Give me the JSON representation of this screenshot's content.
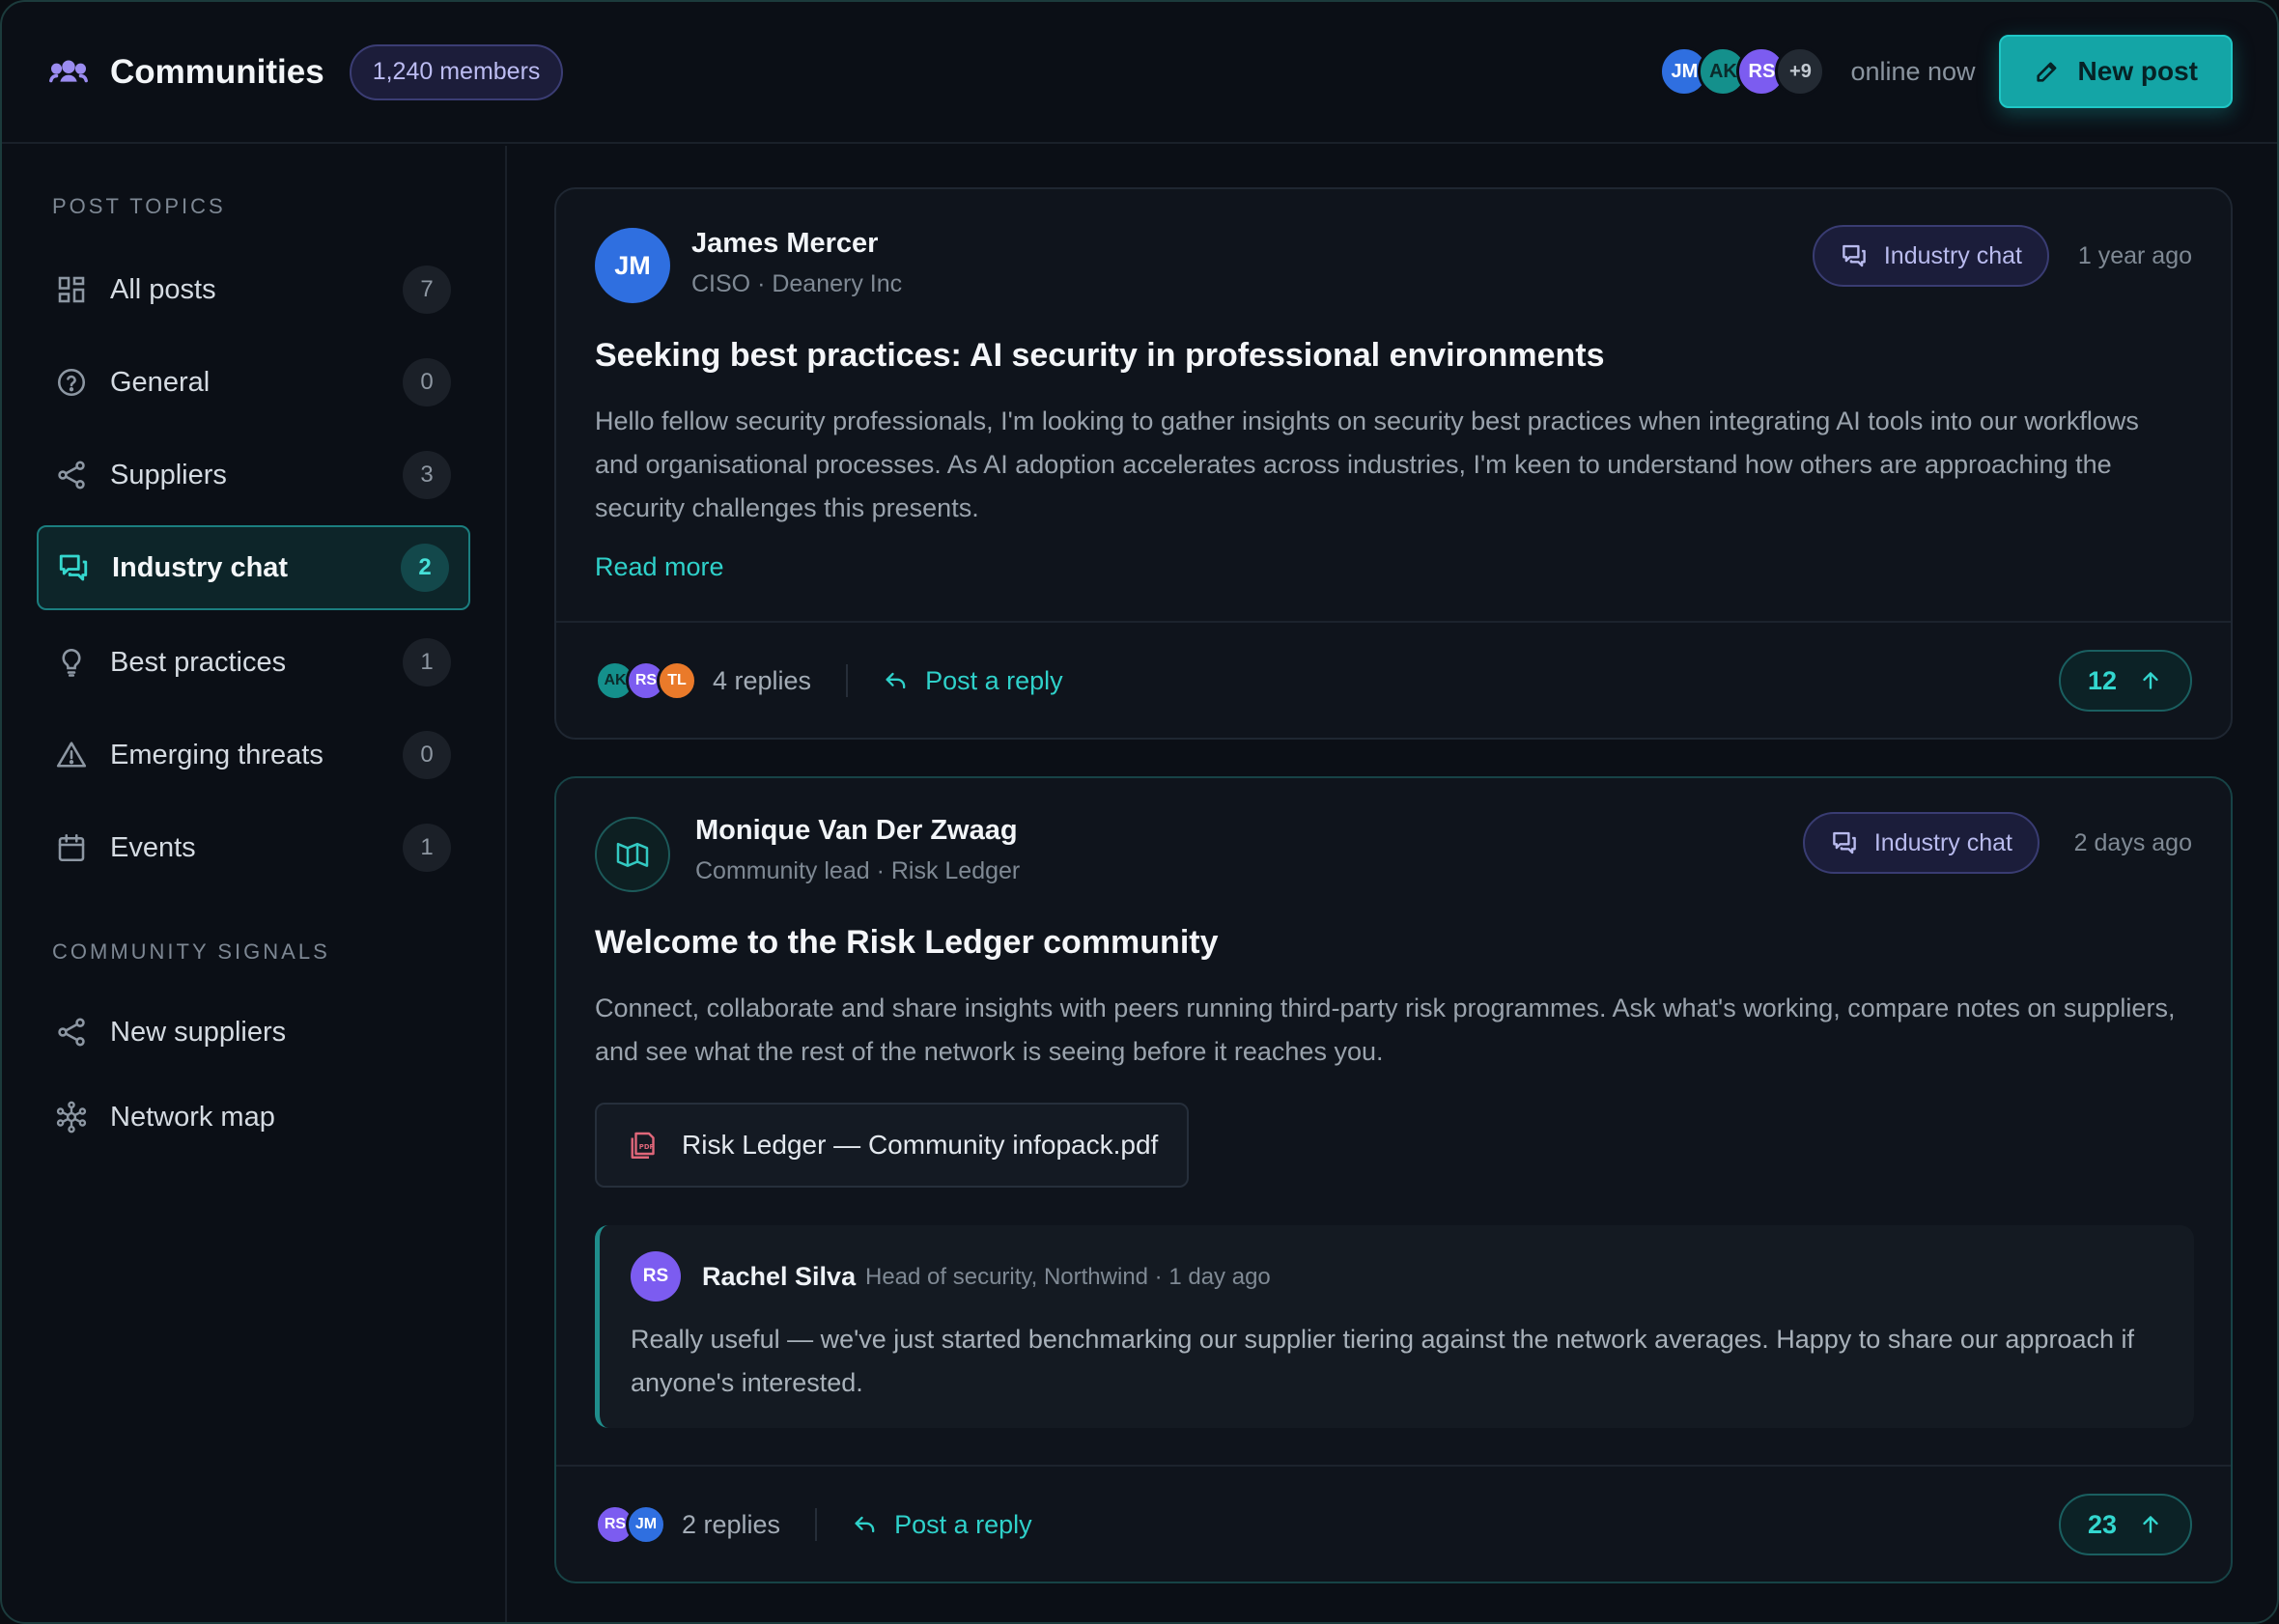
{
  "header": {
    "title": "Communities",
    "members": "1,240 members",
    "online_avatars": [
      "JM",
      "AK",
      "RS",
      "+9"
    ],
    "online_text": "online now",
    "new_post": "New post"
  },
  "sidebar": {
    "topics_label": "POST TOPICS",
    "topics": [
      {
        "label": "All posts",
        "count": "7",
        "icon": "grid-icon"
      },
      {
        "label": "General",
        "count": "0",
        "icon": "question-icon"
      },
      {
        "label": "Suppliers",
        "count": "3",
        "icon": "share-icon"
      },
      {
        "label": "Industry chat",
        "count": "2",
        "icon": "chat-icon",
        "active": true
      },
      {
        "label": "Best practices",
        "count": "1",
        "icon": "lightbulb-icon"
      },
      {
        "label": "Emerging threats",
        "count": "0",
        "icon": "warning-icon"
      },
      {
        "label": "Events",
        "count": "1",
        "icon": "calendar-icon"
      }
    ],
    "signals_label": "COMMUNITY SIGNALS",
    "signals": [
      {
        "label": "New suppliers",
        "icon": "share-icon"
      },
      {
        "label": "Network map",
        "icon": "network-icon"
      }
    ]
  },
  "posts": [
    {
      "avatar": "JM",
      "author": "James Mercer",
      "role": "CISO · Deanery Inc",
      "topic": "Industry chat",
      "time": "1 year ago",
      "title": "Seeking best practices: AI security in professional environments",
      "body": "Hello fellow security professionals, I'm looking to gather insights on security best practices when integrating AI tools into our workflows and organisational processes. As AI adoption accelerates across industries, I'm keen to understand how others are approaching the security challenges this presents.",
      "read_more": "Read more",
      "reply_avatars": [
        "AK",
        "RS",
        "TL"
      ],
      "replies": "4 replies",
      "post_reply": "Post a reply",
      "votes": "12"
    },
    {
      "author": "Monique Van Der Zwaag",
      "role": "Community lead · Risk Ledger",
      "topic": "Industry chat",
      "time": "2 days ago",
      "title": "Welcome to the Risk Ledger community",
      "body": "Connect, collaborate and share insights with peers running third-party risk programmes. Ask what's working, compare notes on suppliers, and see what the rest of the network is seeing before it reaches you.",
      "attachment": "Risk Ledger — Community infopack.pdf",
      "reply": {
        "avatar": "RS",
        "name": "Rachel Silva",
        "meta": "Head of security, Northwind · 1 day ago",
        "text": "Really useful — we've just started benchmarking our supplier tiering against the network averages. Happy to share our approach if anyone's interested."
      },
      "reply_avatars": [
        "RS",
        "JM"
      ],
      "replies": "2 replies",
      "post_reply": "Post a reply",
      "votes": "23"
    }
  ],
  "colors": {
    "accent": "#14a5a6",
    "accent_text": "#2fd1ca",
    "topic_pill_bg": "#1b1d3a",
    "avatar_jm": "#2f6fe0",
    "avatar_ak": "#14908c",
    "avatar_rs": "#7c5cf0",
    "avatar_tl": "#ea7a2a"
  }
}
